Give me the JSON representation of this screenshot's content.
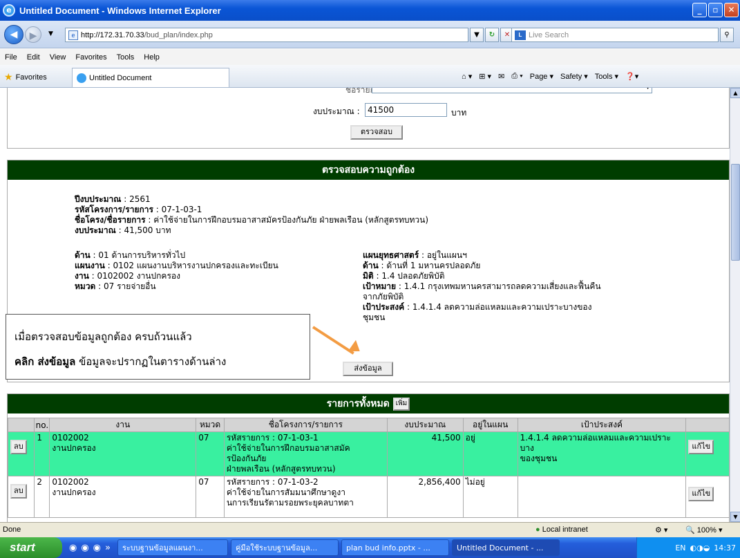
{
  "window": {
    "title": "Untitled Document - Windows Internet Explorer",
    "url_host": "http://172.31.70.33",
    "url_path": "/bud_plan/index.php",
    "search_placeholder": "Live Search"
  },
  "menu": [
    "File",
    "Edit",
    "View",
    "Favorites",
    "Tools",
    "Help"
  ],
  "favbar": {
    "favorites": "Favorites",
    "tab": "Untitled Document",
    "page": "Page",
    "safety": "Safety",
    "tools": "Tools"
  },
  "form": {
    "item_label": "ชื่อรายการ :",
    "budget_label": "งบประมาณ :",
    "budget_value": "41500",
    "unit": "บาท",
    "check_button": "ตรวจสอบ"
  },
  "verify": {
    "header": "ตรวจสอบความถูกต้อง",
    "year_label": "ปีงบประมาณ",
    "year_value": " : 2561",
    "code_label": "รหัสโครงการ/รายการ",
    "code_value": " : 07-1-03-1",
    "name_label": "ชื่อโครง/ชื่อรายการ",
    "name_value": " : ค่าใช้จ่ายในการฝึกอบรมอาสาสมัครป้องกันภัย ฝ่ายพลเรือน (หลักสูตรทบทวน)",
    "budget_label": "งบประมาณ",
    "budget_value": " : 41,500 บาท",
    "side_label": "ด้าน",
    "side_value": " : 01 ด้านการบริหารทั่วไป",
    "plan_label": "แผนงาน",
    "plan_value": " : 0102 แผนงานบริหารงานปกครองและทะเบียน",
    "work_label": "งาน",
    "work_value": " : 0102002 งานปกครอง",
    "cat_label": "หมวด",
    "cat_value": " : 07 รายจ่ายอื่น",
    "strategy_label": "แผนยุทธศาสตร์",
    "strategy_value": " : อยู่ในแผนฯ",
    "dim_label": "ด้าน",
    "dim_value": " : ด้านที่ 1 มหานครปลอดภัย",
    "aspect_label": "มิติ",
    "aspect_value": " : 1.4 ปลอดภัยพิบัติ",
    "target_label": "เป้าหมาย",
    "target_value": " : 1.4.1 กรุงเทพมหานครสามารถลดความเสี่ยงและฟื้นคืน",
    "target_value2": "จากภัยพิบัติ",
    "purpose_label": "เป้าประสงค์",
    "purpose_value": " : 1.4.1.4 ลดความล่อแหลมและความเปราะบางของ",
    "purpose_value2": "ชุมชน",
    "send_button": "ส่งข้อมูล"
  },
  "callout": {
    "line1": "เมื่อตรวจสอบข้อมูลถูกต้อง ครบถ้วนแล้ว",
    "line2_bold": "คลิก ส่งข้อมูล",
    "line2_rest": " ข้อมูลจะปรากฏในตารางด้านล่าง"
  },
  "list": {
    "header": "รายการทั้งหมด",
    "add_button": "เพิ่ม",
    "columns": [
      "no.",
      "งาน",
      "หมวด",
      "ชื่อโครงการ/รายการ",
      "งบประมาณ",
      "อยู่ในแผน",
      "เป้าประสงค์"
    ],
    "rows": [
      {
        "delete": "ลบ",
        "no": "1",
        "work_code": "0102002",
        "work_name": "งานปกครอง",
        "cat": "07",
        "code": "รหัสรายการ : 07-1-03-1",
        "name1": "ค่าใช้จ่ายในการฝึกอบรมอาสาสมัค",
        "name2": "รป้องกันภัย",
        "name3": "ฝ่ายพลเรือน (หลักสูตรทบทวน)",
        "budget": "41,500",
        "inplan": "อยู่",
        "purpose1": "1.4.1.4 ลดความล่อแหลมและความเปราะบาง",
        "purpose2": "ของชุมชน",
        "edit": "แก้ไข"
      },
      {
        "delete": "ลบ",
        "no": "2",
        "work_code": "0102002",
        "work_name": "งานปกครอง",
        "cat": "07",
        "code": "รหัสรายการ : 07-1-03-2",
        "name1": "ค่าใช้จ่ายในการสัมมนาศึกษาดูงา",
        "name2": "นการเรียนรัตามรอยพระยุคลบาทตา",
        "name3": "",
        "budget": "2,856,400",
        "inplan": "ไม่อยู่",
        "purpose1": "",
        "purpose2": "",
        "edit": "แก้ไข"
      }
    ]
  },
  "status": {
    "left": "Done",
    "zone": "Local intranet",
    "zoom": "100%"
  },
  "taskbar": {
    "start": "start",
    "items": [
      "ระบบฐานข้อมูลแผนงา...",
      "คู่มือใช้ระบบฐานข้อมูล...",
      "plan bud info.pptx - ...",
      "Untitled Document - ..."
    ],
    "lang": "EN",
    "time": "14:37"
  }
}
